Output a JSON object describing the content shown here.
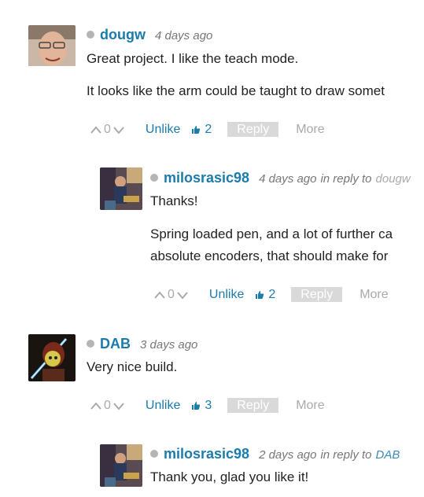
{
  "comments": [
    {
      "author": "dougw",
      "time": "4 days ago",
      "reply_prefix": "",
      "reply_to": "",
      "lines": [
        "Great project. I like the teach mode.",
        "It looks like the arm could be taught to draw somet"
      ],
      "score": "0",
      "unlike_label": "Unlike",
      "likes": "2",
      "reply_label": "Reply",
      "more_label": "More"
    },
    {
      "author": "milosrasic98",
      "time": "4 days ago",
      "reply_prefix": "in reply to",
      "reply_to": "dougw",
      "lines": [
        "Thanks!",
        "Spring loaded pen, and a lot of further ca",
        "absolute encoders, that should make for"
      ],
      "score": "0",
      "unlike_label": "Unlike",
      "likes": "2",
      "reply_label": "Reply",
      "more_label": "More"
    },
    {
      "author": "DAB",
      "time": "3 days ago",
      "reply_prefix": "",
      "reply_to": "",
      "lines": [
        "Very nice build."
      ],
      "score": "0",
      "unlike_label": "Unlike",
      "likes": "3",
      "reply_label": "Reply",
      "more_label": "More"
    },
    {
      "author": "milosrasic98",
      "time": "2 days ago",
      "reply_prefix": "in reply to",
      "reply_to": "DAB",
      "lines": [
        "Thank you, glad you like it!"
      ]
    }
  ],
  "colors": {
    "author": "#1b7bab",
    "muted": "#777777",
    "reply_button_bg": "#d9d9d9"
  },
  "icons": {
    "vote_up": "chevron-up-icon",
    "vote_down": "chevron-down-icon",
    "like": "thumbs-up-icon",
    "status": "presence-dot-icon"
  }
}
